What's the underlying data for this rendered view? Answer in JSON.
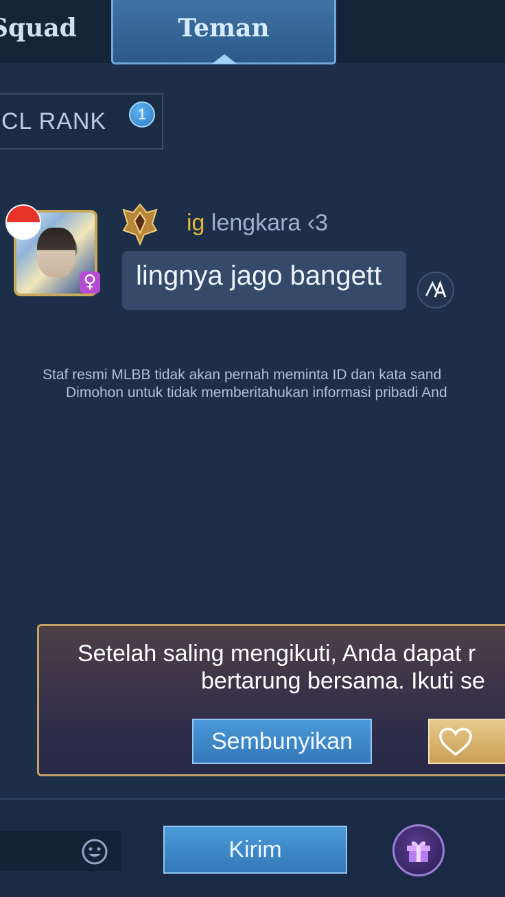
{
  "tabs": [
    {
      "label": "Squad",
      "active": false
    },
    {
      "label": "Teman",
      "active": true
    }
  ],
  "filter": {
    "label": "CL RANK",
    "badge_count": "1"
  },
  "message": {
    "avatar_flag": "indonesia-flag",
    "gender_symbol": "♀",
    "sender_prefix": "ig",
    "sender_name": "lengkara ‹3",
    "text": "lingnya jago bangett",
    "translate_icon": "translate-icon"
  },
  "notice": {
    "line1": "Staf resmi MLBB tidak akan pernah meminta ID dan kata sand",
    "line2": "Dimohon untuk tidak memberitahukan informasi pribadi And"
  },
  "follow_panel": {
    "line1": "Setelah saling mengikuti, Anda dapat r",
    "line2": "bertarung bersama. Ikuti se",
    "hide_label": "Sembunyikan",
    "follow_icon": "heart-icon"
  },
  "input_bar": {
    "placeholder": "",
    "send_label": "Kirim",
    "emoji_icon": "emoji-icon",
    "gift_icon": "gift-icon"
  },
  "colors": {
    "background": "#1d2e49",
    "accent_blue": "#3f78b6",
    "gold": "#c4a466",
    "username_prefix": "#e2b73b"
  }
}
